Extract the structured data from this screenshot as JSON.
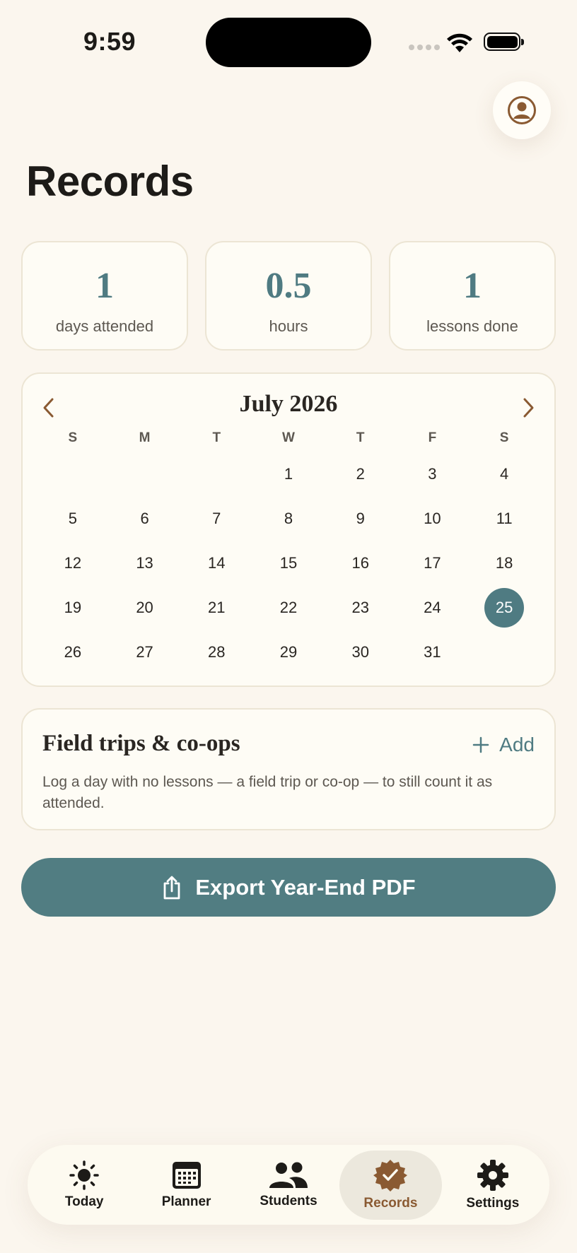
{
  "status_bar": {
    "time": "9:59"
  },
  "header": {
    "title": "Records"
  },
  "stats": [
    {
      "value": "1",
      "label": "days attended"
    },
    {
      "value": "0.5",
      "label": "hours"
    },
    {
      "value": "1",
      "label": "lessons done"
    }
  ],
  "calendar": {
    "month_title": "July 2026",
    "weekdays": [
      "S",
      "M",
      "T",
      "W",
      "T",
      "F",
      "S"
    ],
    "leading_blanks": 3,
    "days": [
      "1",
      "2",
      "3",
      "4",
      "5",
      "6",
      "7",
      "8",
      "9",
      "10",
      "11",
      "12",
      "13",
      "14",
      "15",
      "16",
      "17",
      "18",
      "19",
      "20",
      "21",
      "22",
      "23",
      "24",
      "25",
      "26",
      "27",
      "28",
      "29",
      "30",
      "31"
    ],
    "selected_day": "25",
    "accent_color": "#4f7b82"
  },
  "field_trips": {
    "title": "Field trips & co-ops",
    "add_label": "Add",
    "description": "Log a day with no lessons — a field trip or co-op — to still count it as attended."
  },
  "export": {
    "label": "Export Year-End PDF"
  },
  "tabs": [
    {
      "label": "Today",
      "icon": "sun-icon"
    },
    {
      "label": "Planner",
      "icon": "calendar-icon"
    },
    {
      "label": "Students",
      "icon": "people-icon"
    },
    {
      "label": "Records",
      "icon": "badge-check-icon",
      "active": true
    },
    {
      "label": "Settings",
      "icon": "gear-icon"
    }
  ],
  "colors": {
    "background": "#fbf6ee",
    "accent": "#4f7b82",
    "brown": "#8a5a32"
  }
}
